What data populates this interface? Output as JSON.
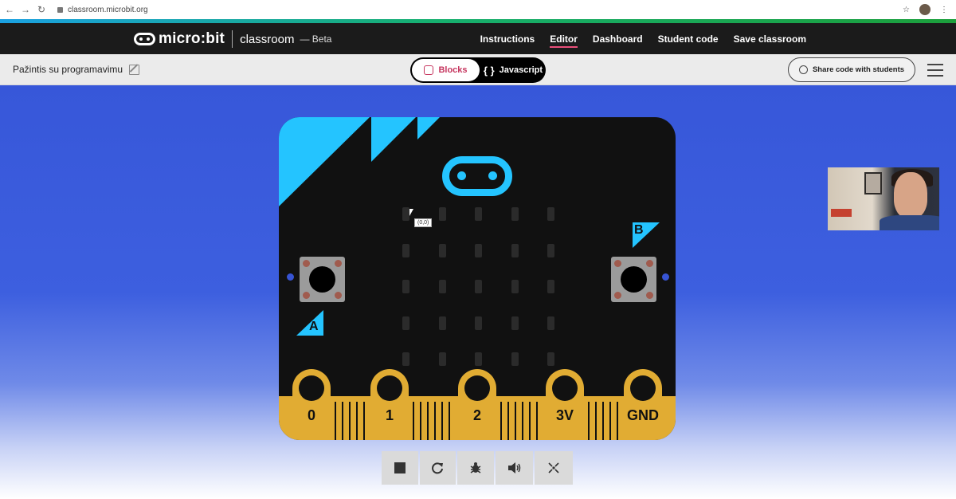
{
  "browser": {
    "url": "classroom.microbit.org"
  },
  "header": {
    "brand": "micro:bit",
    "product": "classroom",
    "badge": "Beta",
    "nav": [
      "Instructions",
      "Editor",
      "Dashboard",
      "Student code",
      "Save classroom"
    ],
    "active_nav": "Editor",
    "accent": "#e94f7a"
  },
  "toolbar": {
    "project_name": "Pažintis su programavimu",
    "blocks_label": "Blocks",
    "js_label": "Javascript",
    "js_glyph": "{ }",
    "share_label": "Share code with students"
  },
  "simulator": {
    "pins": [
      "0",
      "1",
      "2",
      "3V",
      "GND"
    ],
    "button_a": "A",
    "button_b": "B",
    "tooltip": "(0,0)",
    "board_accent": "#24c4ff",
    "edge_color": "#e1ac33"
  },
  "sim_controls": [
    "stop-icon",
    "restart-icon",
    "debug-icon",
    "sound-icon",
    "fullscreen-icon"
  ]
}
